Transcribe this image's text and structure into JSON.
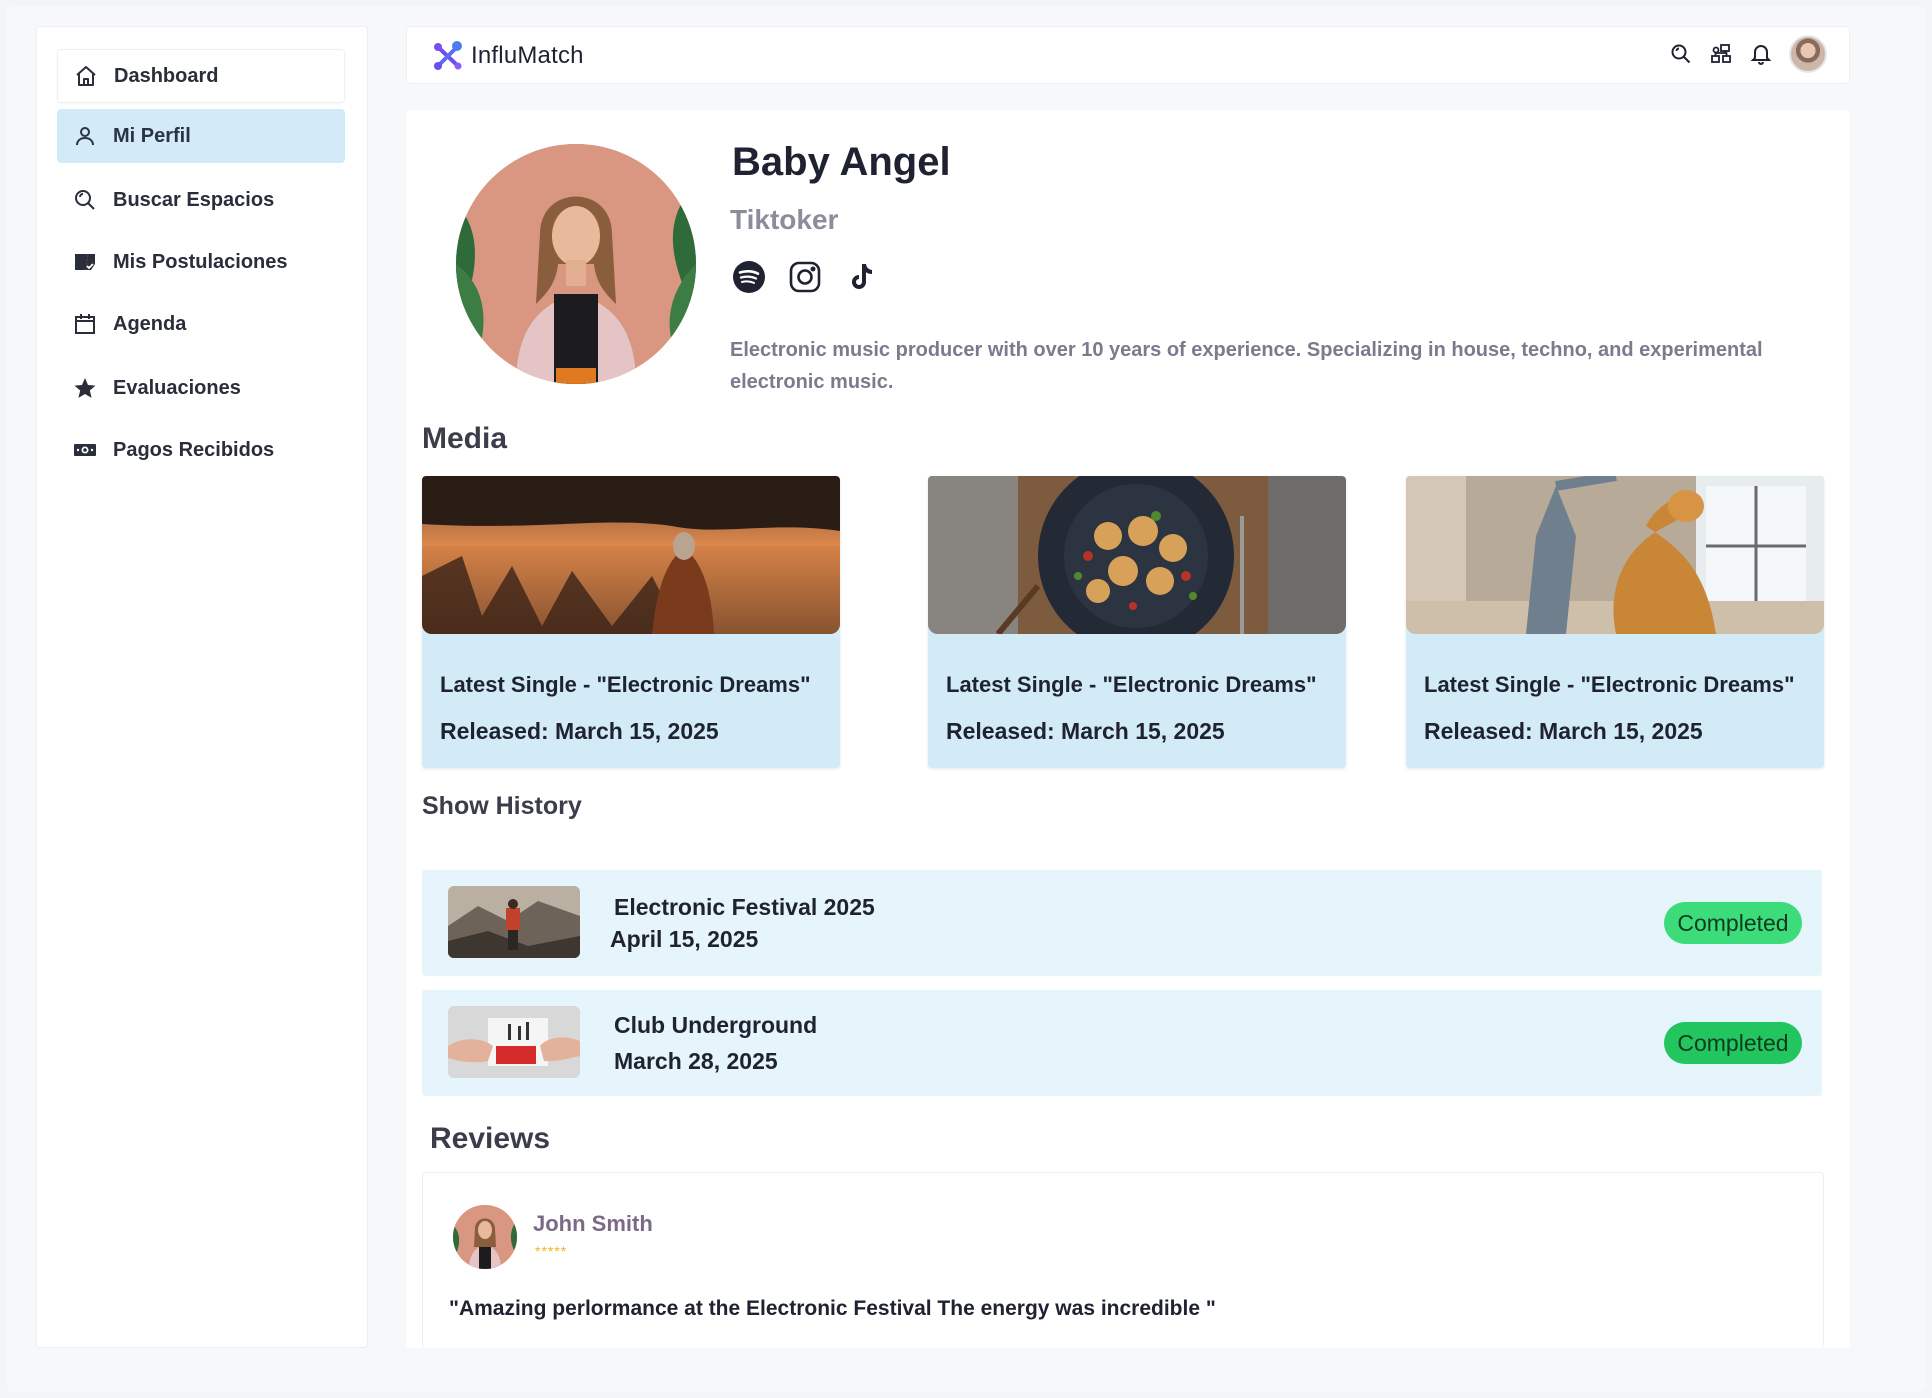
{
  "sidebar": {
    "items": [
      {
        "label": "Dashboard",
        "icon": "home-icon"
      },
      {
        "label": "Mi Perfil",
        "icon": "user-icon"
      },
      {
        "label": "Buscar Espacios",
        "icon": "search-icon"
      },
      {
        "label": "Mis Postulaciones",
        "icon": "postulation-icon"
      },
      {
        "label": "Agenda",
        "icon": "calendar-icon"
      },
      {
        "label": "Evaluaciones",
        "icon": "star-icon"
      },
      {
        "label": "Pagos Recibidos",
        "icon": "money-icon"
      }
    ],
    "active_index": 1
  },
  "header": {
    "brand": "InfluMatch",
    "icons": [
      "search-icon",
      "network-icon",
      "bell-icon",
      "avatar"
    ]
  },
  "profile": {
    "name": "Baby Angel",
    "role": "Tiktoker",
    "socials": [
      "spotify-icon",
      "instagram-icon",
      "tiktok-icon"
    ],
    "bio": "Electronic music producer with over 10 years of experience. Specializing in house, techno, and experimental electronic music."
  },
  "media": {
    "title": "Media",
    "items": [
      {
        "title": "Latest Single - \"Electronic Dreams\"",
        "released": "Released: March 15, 2025",
        "image": "lake-sunset"
      },
      {
        "title": "Latest Single - \"Electronic Dreams\"",
        "released": "Released: March 15, 2025",
        "image": "food-plate"
      },
      {
        "title": "Latest Single - \"Electronic Dreams\"",
        "released": "Released: March 15, 2025",
        "image": "dog-jumping"
      }
    ]
  },
  "show_history": {
    "title": "Show History",
    "items": [
      {
        "name": "Electronic Festival 2025",
        "date": "April 15, 2025",
        "status": "Completed",
        "status_color": "#3ddc7b"
      },
      {
        "name": "Club Underground",
        "date": "March 28, 2025",
        "status": "Completed",
        "status_color": "#22c55e"
      }
    ]
  },
  "reviews": {
    "title": "Reviews",
    "items": [
      {
        "author": "John Smith",
        "stars": "*****",
        "text": "\"Amazing perlormance at the Electronic Festival  The energy was incredible \""
      }
    ]
  },
  "colors": {
    "accent": "#6c4cf1",
    "active_nav": "#d3ebf7",
    "row_bg": "#e6f5fc",
    "star": "#f2b21b"
  }
}
